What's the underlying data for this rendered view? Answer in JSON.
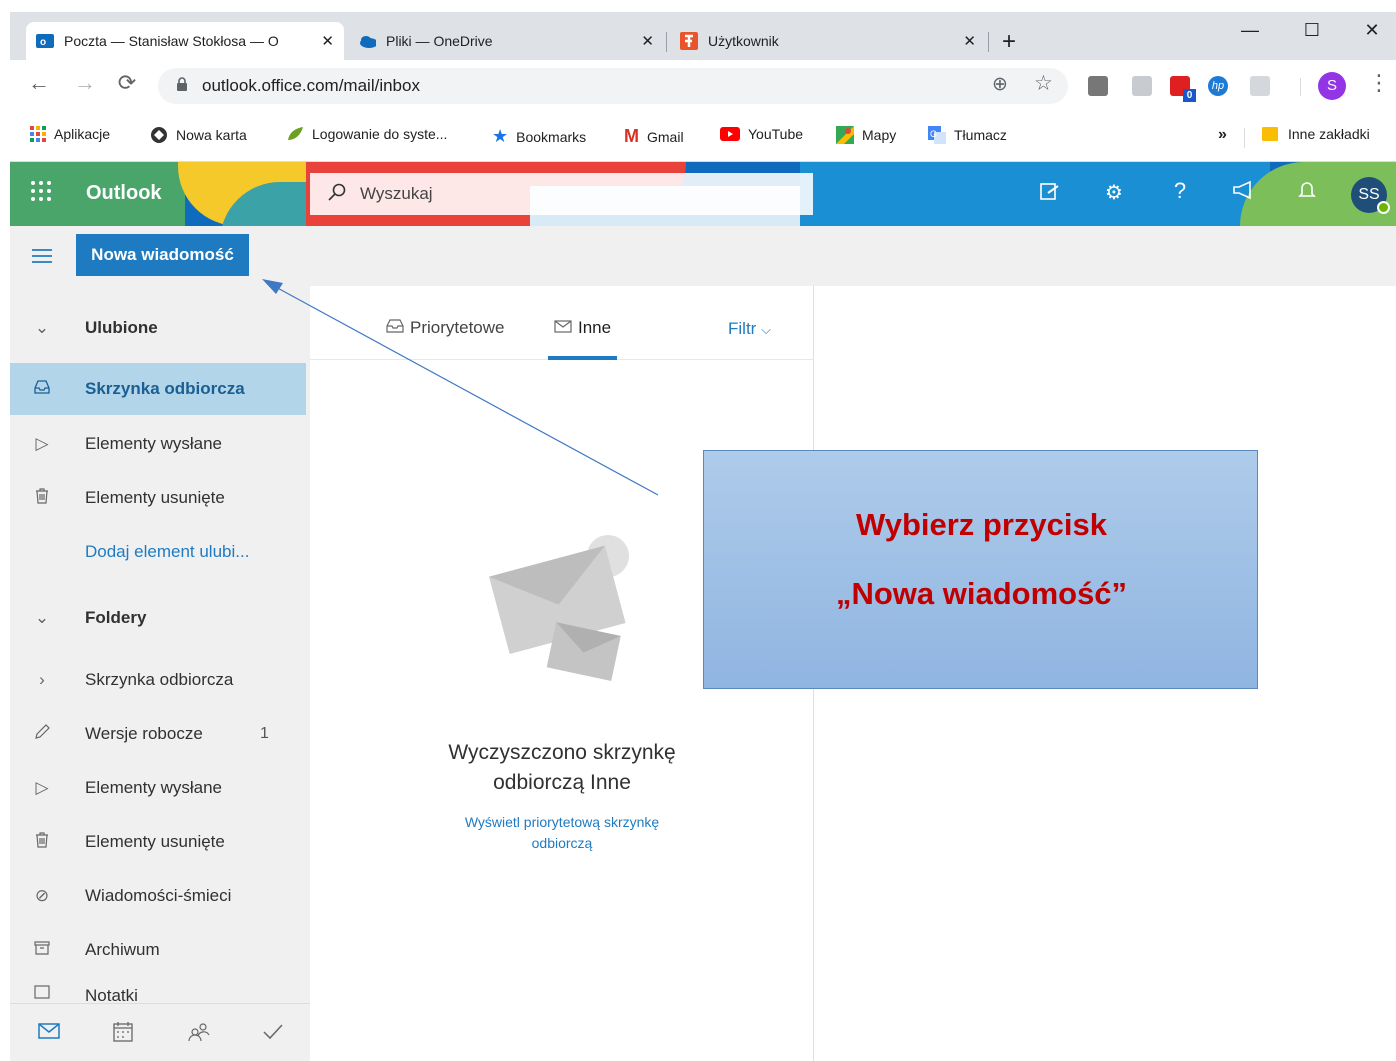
{
  "browser": {
    "tabs": [
      {
        "title": "Poczta — Stanisław Stokłosa — O",
        "close": "✕",
        "icon": "outlook-icon"
      },
      {
        "title": "Pliki — OneDrive",
        "close": "✕",
        "icon": "onedrive-icon"
      },
      {
        "title": "Użytkownik",
        "close": "✕",
        "icon": "user-app-icon"
      }
    ],
    "new_tab": "+",
    "window_controls": {
      "minimize": "—",
      "maximize": "☐",
      "close": "✕"
    },
    "address": "outlook.office.com/mail/inbox",
    "profile_initial": "S",
    "bookmarks": [
      {
        "label": "Aplikacje",
        "icon": "apps-icon"
      },
      {
        "label": "Nowa karta",
        "icon": "globe-icon"
      },
      {
        "label": "Logowanie do syste...",
        "icon": "leaf-icon"
      },
      {
        "label": "Bookmarks",
        "icon": "star-icon"
      },
      {
        "label": "Gmail",
        "icon": "gmail-icon"
      },
      {
        "label": "YouTube",
        "icon": "youtube-icon"
      },
      {
        "label": "Mapy",
        "icon": "maps-icon"
      },
      {
        "label": "Tłumacz",
        "icon": "translate-icon"
      }
    ],
    "more_bookmarks": "»",
    "other_bookmarks": "Inne zakładki",
    "extension_badge": "0"
  },
  "outlook": {
    "brand": "Outlook",
    "search_placeholder": "Wyszukaj",
    "avatar_initials": "SS",
    "new_message": "Nowa wiadomość",
    "favorites_header": "Ulubione",
    "favorites": [
      {
        "label": "Skrzynka odbiorcza",
        "icon": "inbox-icon",
        "selected": true
      },
      {
        "label": "Elementy wysłane",
        "icon": "sent-icon"
      },
      {
        "label": "Elementy usunięte",
        "icon": "trash-icon"
      },
      {
        "label": "Dodaj element ulubi...",
        "icon": "",
        "link": true
      }
    ],
    "folders_header": "Foldery",
    "folders": [
      {
        "label": "Skrzynka odbiorcza",
        "icon": "chevron-right-icon"
      },
      {
        "label": "Wersje robocze",
        "icon": "pencil-icon",
        "count": "1"
      },
      {
        "label": "Elementy wysłane",
        "icon": "sent-icon"
      },
      {
        "label": "Elementy usunięte",
        "icon": "trash-icon"
      },
      {
        "label": "Wiadomości-śmieci",
        "icon": "block-icon"
      },
      {
        "label": "Archiwum",
        "icon": "archive-icon"
      },
      {
        "label": "Notatki",
        "icon": "note-icon"
      }
    ],
    "pivot": {
      "focused": "Priorytetowe",
      "other": "Inne",
      "filter": "Filtr"
    },
    "empty_state": {
      "title_line1": "Wyczyszczono skrzynkę",
      "title_line2": "odbiorczą Inne",
      "link_line1": "Wyświetl priorytetową skrzynkę",
      "link_line2": "odbiorczą"
    }
  },
  "callout": {
    "line1": "Wybierz przycisk",
    "line2": "„Nowa wiadomość”",
    "text_color": "#c00000"
  },
  "colors": {
    "accent": "#1f7bc1",
    "selected_bg": "#b3d5ea"
  }
}
